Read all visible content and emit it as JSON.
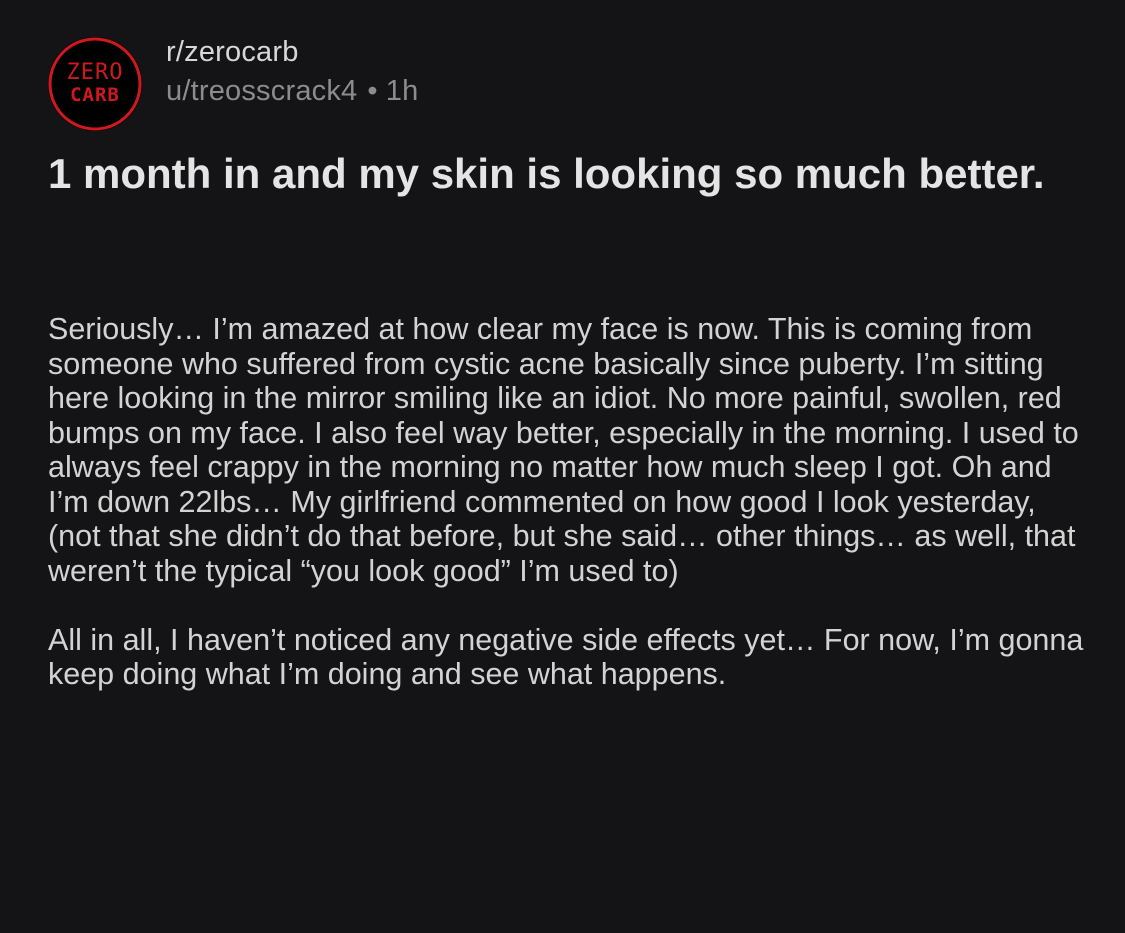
{
  "post": {
    "subreddit": "r/zerocarb",
    "author": "u/treosscrack4",
    "separator": "•",
    "age": "1h",
    "avatar": {
      "line1": "ZERO",
      "line2": "CARB",
      "colors": {
        "background": "#000000",
        "ring": "#d0181f",
        "text": "#d0181f"
      }
    },
    "title": "1 month in and my skin is looking so much better.",
    "body": [
      "Seriously… I’m amazed at how clear my face is now. This is coming from someone who suffered from cystic acne basically since puberty. I’m sitting here looking in the mirror smiling like an idiot. No more painful, swollen, red bumps on my face. I also feel way better, especially in the morning. I used to always feel crappy in the morning no matter how much sleep I got. Oh and I’m down 22lbs… My girlfriend commented on how good I look yesterday, (not that she didn’t do that before, but she said… other things… as well, that weren’t the typical “you look good” I’m used to)",
      "All in all, I haven’t noticed any negative side effects yet… For now, I’m gonna keep doing what I’m doing and see what happens."
    ]
  },
  "theme": {
    "background": "#141416",
    "text_primary": "#e4e4e4",
    "text_secondary": "#8c8c8c",
    "accent": "#d0181f"
  }
}
